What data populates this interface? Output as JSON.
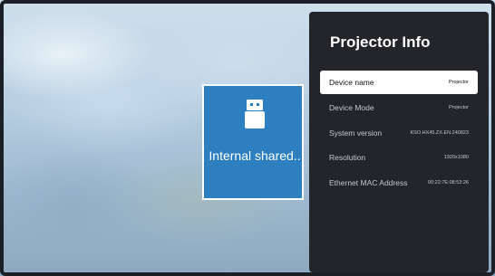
{
  "storage_tile": {
    "label": "Internal shared..",
    "icon": "usb-drive-icon",
    "accent": "#2d7fbf"
  },
  "info_panel": {
    "title": "Projector Info",
    "background": "#23252b",
    "rows": [
      {
        "label": "Device name",
        "value": "Projector",
        "selected": true
      },
      {
        "label": "Device Mode",
        "value": "Projector",
        "selected": false
      },
      {
        "label": "System version",
        "value": "KSO.HX45.ZX.EN.240823",
        "selected": false
      },
      {
        "label": "Resolution",
        "value": "1920x1080",
        "selected": false
      },
      {
        "label": "Ethernet MAC Address",
        "value": "00:22:7E:08:53:26",
        "selected": false
      }
    ]
  }
}
